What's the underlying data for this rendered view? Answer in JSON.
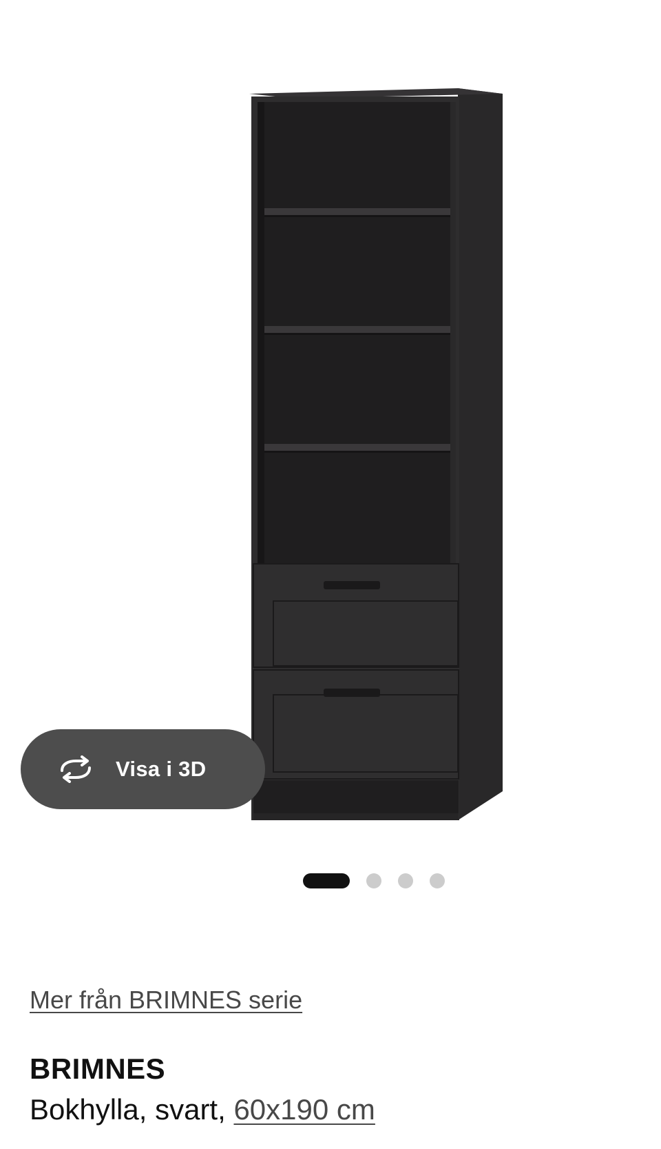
{
  "gallery": {
    "image_alt": "BRIMNES bookcase",
    "view_3d_label": "Visa i 3D",
    "view_3d_icon": "rotate-3d-icon",
    "page_count": 4,
    "active_page": 1
  },
  "product": {
    "series_link": "Mer från BRIMNES serie",
    "name": "BRIMNES",
    "description_prefix": "Bokhylla, svart, ",
    "size_link": "60x190 cm"
  },
  "colors": {
    "button_bg": "#4d4d4d",
    "dot_active": "#111111",
    "dot_inactive": "#cccccc",
    "link_text": "#484848",
    "furniture": "#2f2e2f"
  }
}
